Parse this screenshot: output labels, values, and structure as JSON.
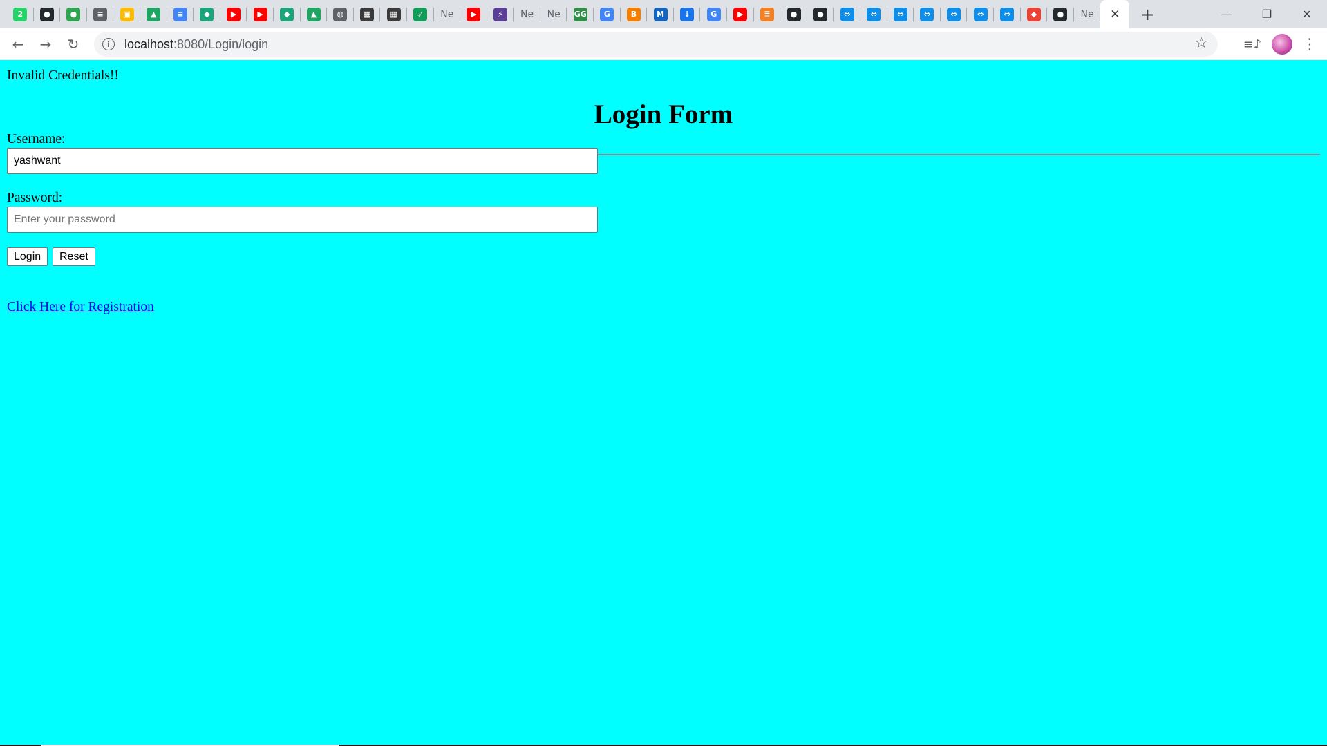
{
  "browser": {
    "tabs": [
      {
        "icon": "whatsapp-icon",
        "glyph": "2",
        "color": "#25d366"
      },
      {
        "icon": "github-icon",
        "glyph": "●",
        "color": "#24292e"
      },
      {
        "icon": "github-green-icon",
        "glyph": "●",
        "color": "#2ea44f"
      },
      {
        "icon": "bookmark-list-icon",
        "glyph": "≡",
        "color": "#5f6368"
      },
      {
        "icon": "google-keep-icon",
        "glyph": "▣",
        "color": "#fbbc04"
      },
      {
        "icon": "google-drive-icon",
        "glyph": "▲",
        "color": "#1fa463"
      },
      {
        "icon": "google-docs-icon",
        "glyph": "≡",
        "color": "#4285f4"
      },
      {
        "icon": "shield-icon",
        "glyph": "◆",
        "color": "#1aa67a"
      },
      {
        "icon": "youtube-icon",
        "glyph": "▶",
        "color": "#ff0000"
      },
      {
        "icon": "youtube-icon",
        "glyph": "▶",
        "color": "#ff0000"
      },
      {
        "icon": "shield-icon",
        "glyph": "◆",
        "color": "#1aa67a"
      },
      {
        "icon": "google-drive-icon",
        "glyph": "▲",
        "color": "#1fa463"
      },
      {
        "icon": "globe-icon",
        "glyph": "◍",
        "color": "#5f6368"
      },
      {
        "icon": "photo-icon",
        "glyph": "▦",
        "color": "#3a3a3a"
      },
      {
        "icon": "photo-icon",
        "glyph": "▦",
        "color": "#3a3a3a"
      },
      {
        "icon": "rocket-icon",
        "glyph": "➶",
        "color": "#0f9d58"
      },
      {
        "icon": "text-favicon",
        "glyph": "Ne",
        "text": true
      },
      {
        "icon": "youtube-icon",
        "glyph": "▶",
        "color": "#ff0000"
      },
      {
        "icon": "bolt-icon",
        "glyph": "⚡",
        "color": "#5b3e96"
      },
      {
        "icon": "text-favicon",
        "glyph": "Ne",
        "text": true
      },
      {
        "icon": "text-favicon",
        "glyph": "Ne",
        "text": true
      },
      {
        "icon": "geeksforgeeks-icon",
        "glyph": "GG",
        "color": "#2f8d46"
      },
      {
        "icon": "google-icon",
        "glyph": "G",
        "color": "#4285f4"
      },
      {
        "icon": "blogger-icon",
        "glyph": "B",
        "color": "#f57d00"
      },
      {
        "icon": "maven-icon",
        "glyph": "M",
        "color": "#1565c0"
      },
      {
        "icon": "download-icon",
        "glyph": "↓",
        "color": "#1a73e8"
      },
      {
        "icon": "google-icon",
        "glyph": "G",
        "color": "#4285f4"
      },
      {
        "icon": "youtube-icon",
        "glyph": "▶",
        "color": "#ff0000"
      },
      {
        "icon": "stackoverflow-icon",
        "glyph": "≣",
        "color": "#f48024"
      },
      {
        "icon": "github-icon",
        "glyph": "●",
        "color": "#24292e"
      },
      {
        "icon": "github-icon",
        "glyph": "●",
        "color": "#24292e"
      },
      {
        "icon": "teamviewer-icon",
        "glyph": "⇔",
        "color": "#0e8ee9"
      },
      {
        "icon": "teamviewer-icon",
        "glyph": "⇔",
        "color": "#0e8ee9"
      },
      {
        "icon": "teamviewer-icon",
        "glyph": "⇔",
        "color": "#0e8ee9"
      },
      {
        "icon": "teamviewer-icon",
        "glyph": "⇔",
        "color": "#0e8ee9"
      },
      {
        "icon": "teamviewer-icon",
        "glyph": "⇔",
        "color": "#0e8ee9"
      },
      {
        "icon": "teamviewer-icon",
        "glyph": "⇔",
        "color": "#0e8ee9"
      },
      {
        "icon": "teamviewer-icon",
        "glyph": "⇔",
        "color": "#0e8ee9"
      },
      {
        "icon": "colorful-diamond-icon",
        "glyph": "◆",
        "color": "#ea4335"
      },
      {
        "icon": "github-icon",
        "glyph": "●",
        "color": "#24292e"
      },
      {
        "icon": "text-favicon",
        "glyph": "Ne",
        "text": true
      }
    ],
    "active_tab_close": "✕",
    "new_tab": "+",
    "window_controls": {
      "minimize": "—",
      "restore": "❐",
      "close": "✕"
    },
    "nav": {
      "back": "←",
      "forward": "→",
      "reload": "↻"
    },
    "url_host": "localhost",
    "url_path": ":8080/Login/login",
    "star": "☆",
    "media": "≡♪",
    "menu": "⋮"
  },
  "page": {
    "error_message": "Invalid Credentials!!",
    "title": "Login Form",
    "username_label": "Username:",
    "username_value": "yashwant",
    "password_label": "Password:",
    "password_placeholder": "Enter your password",
    "login_button": "Login",
    "reset_button": "Reset",
    "registration_link": "Click Here for Registration"
  }
}
